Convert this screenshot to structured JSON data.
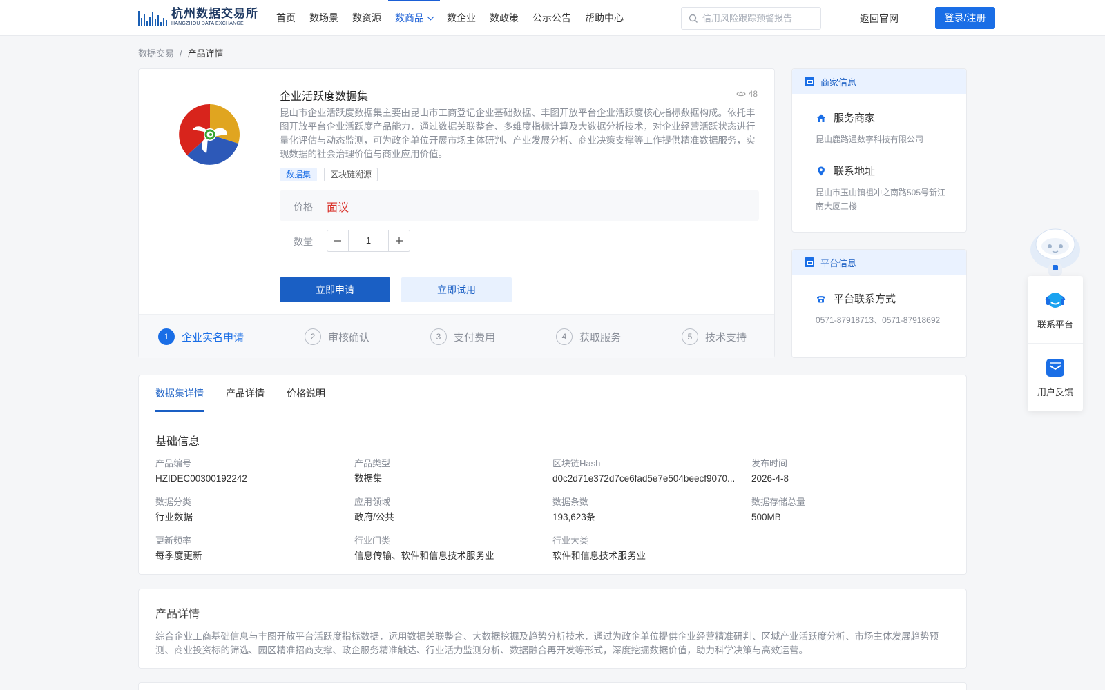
{
  "header": {
    "logo_cn": "杭州数据交易所",
    "logo_en": "HANGZHOU DATA EXCHANGE",
    "nav": [
      "首页",
      "数场景",
      "数资源",
      "数商品",
      "数企业",
      "数政策",
      "公示公告",
      "帮助中心"
    ],
    "active_nav": "数商品",
    "search_placeholder": "信用风险跟踪预警报告",
    "back_link": "返回官网",
    "login": "登录/注册",
    "accent_color": "#1a6ee6"
  },
  "breadcrumb": {
    "root": "数据交易",
    "sep": "/",
    "current": "产品详情"
  },
  "product": {
    "title": "企业活跃度数据集",
    "views": "48",
    "description": "昆山市企业活跃度数据集主要由昆山市工商登记企业基础数据、丰图开放平台企业活跃度核心指标数据构成。依托丰图开放平台企业活跃度产品能力，通过数据关联整合、多维度指标计算及大数据分析技术，对企业经营活跃状态进行量化评估与动态监测，可为政企单位开展市场主体研判、产业发展分析、商业决策支撑等工作提供精准数据服务，实现数据的社会治理价值与商业应用价值。",
    "tags": [
      "数据集",
      "区块链溯源"
    ],
    "price_label": "价格",
    "price_value": "面议",
    "qty_label": "数量",
    "qty_value": "1",
    "apply_btn": "立即申请",
    "trial_btn": "立即试用",
    "steps": [
      {
        "num": "1",
        "label": "企业实名申请"
      },
      {
        "num": "2",
        "label": "审核确认"
      },
      {
        "num": "3",
        "label": "支付费用"
      },
      {
        "num": "4",
        "label": "获取服务"
      },
      {
        "num": "5",
        "label": "技术支持"
      }
    ]
  },
  "merchant": {
    "head": "商家信息",
    "service_label": "服务商家",
    "service_value": "昆山鹿路通数字科技有限公司",
    "address_label": "联系地址",
    "address_value": "昆山市玉山镇祖冲之南路505号新江南大厦三楼"
  },
  "platform": {
    "head": "平台信息",
    "contact_label": "平台联系方式",
    "contact_value": "0571-87918713、0571-87918692"
  },
  "float": {
    "contact": "联系平台",
    "feedback": "用户反馈"
  },
  "detail_tabs": [
    "数据集详情",
    "产品详情",
    "价格说明"
  ],
  "basic": {
    "title": "基础信息",
    "fields": [
      {
        "label": "产品编号",
        "value": "HZIDEC00300192242"
      },
      {
        "label": "产品类型",
        "value": "数据集"
      },
      {
        "label": "区块链Hash",
        "value": "d0c2d71e372d7ce6fad5e7e504beecf9070..."
      },
      {
        "label": "发布时间",
        "value": "2026-4-8"
      },
      {
        "label": "数据分类",
        "value": "行业数据"
      },
      {
        "label": "应用领域",
        "value": "政府/公共"
      },
      {
        "label": "数据条数",
        "value": "193,623条"
      },
      {
        "label": "数据存储总量",
        "value": "500MB"
      },
      {
        "label": "更新频率",
        "value": "每季度更新"
      },
      {
        "label": "行业门类",
        "value": "信息传输、软件和信息技术服务业"
      },
      {
        "label": "行业大类",
        "value": "软件和信息技术服务业"
      }
    ]
  },
  "product_detail": {
    "title": "产品详情",
    "text": "综合企业工商基础信息与丰图开放平台活跃度指标数据，运用数据关联整合、大数据挖掘及趋势分析技术，通过为政企单位提供企业经营精准研判、区域产业活跃度分析、市场主体发展趋势预测、商业投资标的筛选、园区精准招商支撑、政企服务精准触达、行业活力监测分析、数据融合再开发等形式，深度挖掘数据价值，助力科学决策与高效运营。"
  }
}
